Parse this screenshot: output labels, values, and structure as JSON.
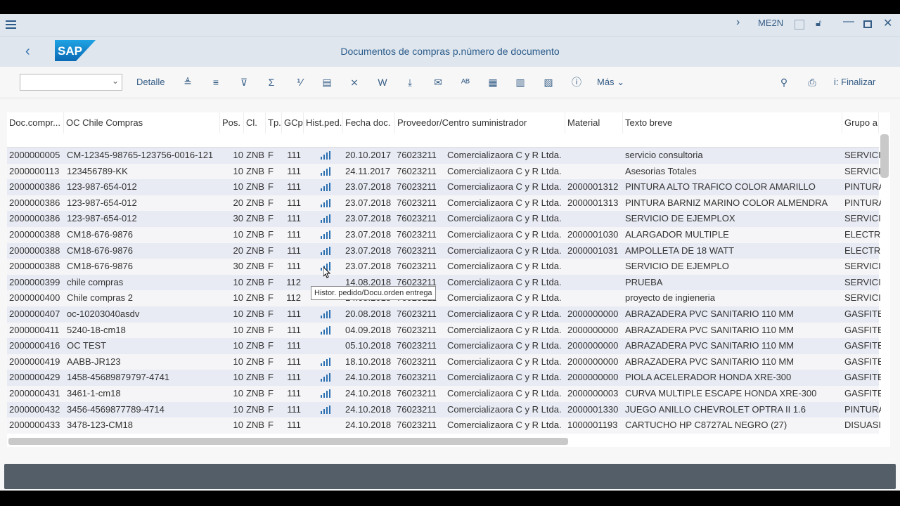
{
  "titlebar": {
    "transaction": "ME2N"
  },
  "shell": {
    "title": "Documentos de compras p.número de documento"
  },
  "toolbar": {
    "detalle": "Detalle",
    "mas": "Más",
    "finalizar": "Finalizar",
    "select_value": ""
  },
  "columns": [
    "Doc.compr...",
    "OC Chile Compras",
    "Pos.",
    "Cl.",
    "Tp.",
    "GCp",
    "Hist.ped.",
    "Fecha doc.",
    "Proveedor/Centro suministrador",
    "Material",
    "Texto breve",
    "Grupo a"
  ],
  "rows": [
    [
      "2000000005",
      "CM-12345-98765-123756-0016-121",
      "10",
      "ZNB",
      "F",
      "111",
      true,
      "20.10.2017",
      "76023211",
      "Comercializaora C y R Ltda.",
      "",
      "servicio consultoria",
      "SERVICI"
    ],
    [
      "2000000113",
      "123456789-KK",
      "10",
      "ZNB",
      "F",
      "111",
      true,
      "24.11.2017",
      "76023211",
      "Comercializaora C y R Ltda.",
      "",
      "Asesorias Totales",
      "SERVICI"
    ],
    [
      "2000000386",
      "123-987-654-012",
      "10",
      "ZNB",
      "F",
      "111",
      true,
      "23.07.2018",
      "76023211",
      "Comercializaora C y R Ltda.",
      "2000001312",
      "PINTURA ALTO TRAFICO COLOR AMARILLO",
      "PINTURA"
    ],
    [
      "2000000386",
      "123-987-654-012",
      "20",
      "ZNB",
      "F",
      "111",
      true,
      "23.07.2018",
      "76023211",
      "Comercializaora C y R Ltda.",
      "2000001313",
      "PINTURA BARNIZ MARINO COLOR ALMENDRA",
      "PINTURA"
    ],
    [
      "2000000386",
      "123-987-654-012",
      "30",
      "ZNB",
      "F",
      "111",
      true,
      "23.07.2018",
      "76023211",
      "Comercializaora C y R Ltda.",
      "",
      "SERVICIO DE EJEMPLOX",
      "SERVICI"
    ],
    [
      "2000000388",
      "CM18-676-9876",
      "10",
      "ZNB",
      "F",
      "111",
      true,
      "23.07.2018",
      "76023211",
      "Comercializaora C y R Ltda.",
      "2000001030",
      "ALARGADOR MULTIPLE",
      "ELECTR"
    ],
    [
      "2000000388",
      "CM18-676-9876",
      "20",
      "ZNB",
      "F",
      "111",
      true,
      "23.07.2018",
      "76023211",
      "Comercializaora C y R Ltda.",
      "2000001031",
      "AMPOLLETA DE 18 WATT",
      "ELECTR"
    ],
    [
      "2000000388",
      "CM18-676-9876",
      "30",
      "ZNB",
      "F",
      "111",
      true,
      "23.07.2018",
      "76023211",
      "Comercializaora C y R Ltda.",
      "",
      "SERVICIO DE EJEMPLO",
      "SERVICI"
    ],
    [
      "2000000399",
      "chile compras",
      "10",
      "ZNB",
      "F",
      "112",
      false,
      "14.08.2018",
      "76023211",
      "Comercializaora C y R Ltda.",
      "",
      "PRUEBA",
      "SERVICI"
    ],
    [
      "2000000400",
      "Chile compras 2",
      "10",
      "ZNB",
      "F",
      "112",
      false,
      "14.08.2018",
      "76023211",
      "Comercializaora C y R Ltda.",
      "",
      "proyecto de ingieneria",
      "SERVICI"
    ],
    [
      "2000000407",
      "oc-10203040asdv",
      "10",
      "ZNB",
      "F",
      "111",
      true,
      "20.08.2018",
      "76023211",
      "Comercializaora C y R Ltda.",
      "2000000000",
      "ABRAZADERA PVC SANITARIO 110 MM",
      "GASFITE"
    ],
    [
      "2000000411",
      "5240-18-cm18",
      "10",
      "ZNB",
      "F",
      "111",
      true,
      "04.09.2018",
      "76023211",
      "Comercializaora C y R Ltda.",
      "2000000000",
      "ABRAZADERA PVC SANITARIO 110 MM",
      "GASFITE"
    ],
    [
      "2000000416",
      "OC TEST",
      "10",
      "ZNB",
      "F",
      "111",
      false,
      "05.10.2018",
      "76023211",
      "Comercializaora C y R Ltda.",
      "2000000000",
      "ABRAZADERA PVC SANITARIO 110 MM",
      "GASFITE"
    ],
    [
      "2000000419",
      "AABB-JR123",
      "10",
      "ZNB",
      "F",
      "111",
      true,
      "18.10.2018",
      "76023211",
      "Comercializaora C y R Ltda.",
      "2000000000",
      "ABRAZADERA PVC SANITARIO 110 MM",
      "GASFITE"
    ],
    [
      "2000000429",
      "1458-45689879797-4741",
      "10",
      "ZNB",
      "F",
      "111",
      true,
      "24.10.2018",
      "76023211",
      "Comercializaora C y R Ltda.",
      "2000000000",
      "PIOLA ACELERADOR HONDA XRE-300",
      "GASFITE"
    ],
    [
      "2000000431",
      "3461-1-cm18",
      "10",
      "ZNB",
      "F",
      "111",
      true,
      "24.10.2018",
      "76023211",
      "Comercializaora C y R Ltda.",
      "2000000003",
      "CURVA MULTIPLE ESCAPE HONDA XRE-300",
      "GASFITE"
    ],
    [
      "2000000432",
      "3456-4569877789-4714",
      "10",
      "ZNB",
      "F",
      "111",
      true,
      "24.10.2018",
      "76023211",
      "Comercializaora C y R Ltda.",
      "2000001330",
      "JUEGO ANILLO CHEVROLET OPTRA II 1.6",
      "PINTURA"
    ],
    [
      "2000000433",
      "3478-123-CM18",
      "10",
      "ZNB",
      "F",
      "111",
      false,
      "24.10.2018",
      "76023211",
      "Comercializaora C y R Ltda.",
      "1000001193",
      "CARTUCHO HP C8727AL NEGRO (27)",
      "DISUASI"
    ]
  ],
  "tooltip": "Histor. pedido/Docu.orden entrega",
  "colors": {
    "shell_bg": "#dfe6ee",
    "accent": "#2a6fb0",
    "row_alt": "#e8ebf4",
    "footer": "#545e68"
  }
}
